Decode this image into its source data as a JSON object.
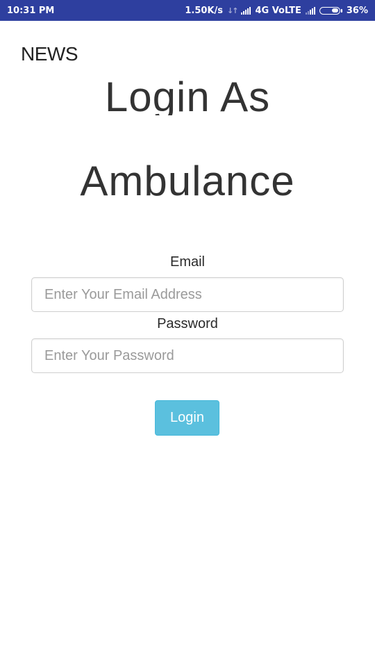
{
  "status_bar": {
    "time": "10:31 PM",
    "speed": "1.50K/s",
    "network": "4G VoLTE",
    "battery_text": "36%",
    "battery_level": 0.36,
    "color": "#2e3f9f"
  },
  "header": {
    "brand": "NEWS"
  },
  "title": {
    "line1": "Login As",
    "line2": "Ambulance"
  },
  "form": {
    "email_label": "Email",
    "email_placeholder": "Enter Your Email Address",
    "email_value": "",
    "password_label": "Password",
    "password_placeholder": "Enter Your Password",
    "password_value": "",
    "login_label": "Login",
    "button_color": "#5bc0de"
  }
}
